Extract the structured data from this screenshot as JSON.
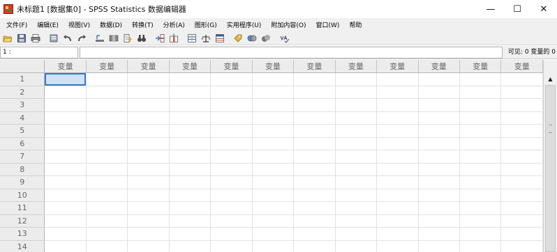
{
  "window": {
    "title": "未标题1 [数据集0] - SPSS Statistics 数据编辑器",
    "controls": {
      "minimize": "—",
      "maximize": "☐",
      "close": "✕"
    }
  },
  "menu": [
    "文件(F)",
    "编辑(E)",
    "视图(V)",
    "数据(D)",
    "转换(T)",
    "分析(A)",
    "图形(G)",
    "实用程序(U)",
    "附加内容(O)",
    "窗口(W)",
    "帮助"
  ],
  "toolbar": {
    "icons": [
      "open-folder",
      "save",
      "print",
      "dialog-recall",
      "undo",
      "redo",
      "goto-case",
      "goto-variable",
      "variables",
      "find",
      "insert-cases",
      "insert-variable",
      "split-file",
      "weight-cases",
      "select-cases",
      "value-labels",
      "use-sets",
      "show-all-variables",
      "spelling"
    ]
  },
  "cellbar": {
    "ref": "1 :",
    "value": "",
    "visible": "可见: 0 变量的 0"
  },
  "grid": {
    "column_label": "变量",
    "column_count": 12,
    "rows": [
      "1",
      "2",
      "3",
      "4",
      "5",
      "6",
      "7",
      "8",
      "9",
      "10",
      "11",
      "12",
      "13",
      "14"
    ],
    "active_cell": {
      "row": "1",
      "column": "1"
    }
  },
  "colors": {
    "grid_line": "#e2e2e2",
    "header_bg": "#ececec",
    "active_cell": "#cfe3f6",
    "active_border": "#3a77c4"
  }
}
